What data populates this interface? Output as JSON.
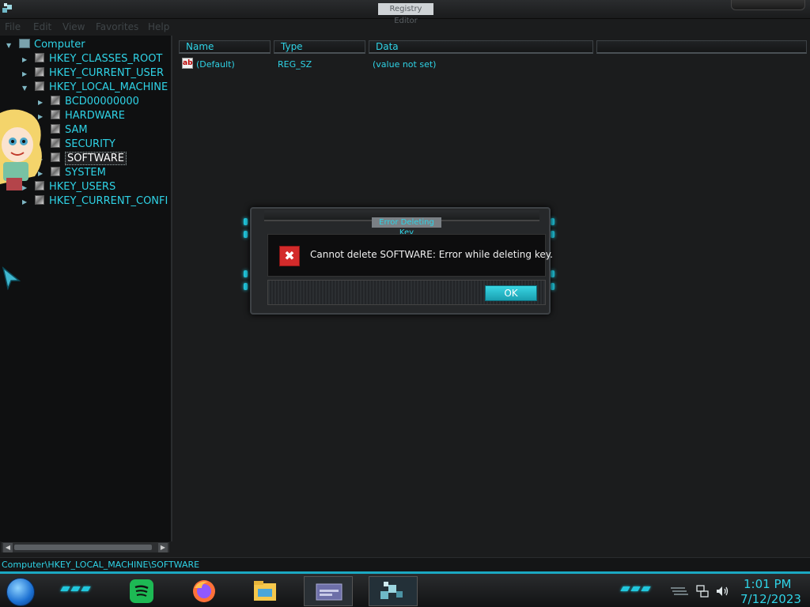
{
  "window": {
    "title": "Registry Editor"
  },
  "menu": [
    "File",
    "Edit",
    "View",
    "Favorites",
    "Help"
  ],
  "tree": {
    "root": "Computer",
    "hives": [
      "HKEY_CLASSES_ROOT",
      "HKEY_CURRENT_USER",
      "HKEY_LOCAL_MACHINE"
    ],
    "local_machine_children": [
      "BCD00000000",
      "HARDWARE",
      "SAM",
      "SECURITY",
      "SOFTWARE",
      "SYSTEM"
    ],
    "bottom_hives": [
      "HKEY_USERS",
      "HKEY_CURRENT_CONFI"
    ]
  },
  "list": {
    "columns": [
      "Name",
      "Type",
      "Data"
    ],
    "rows": [
      {
        "name": "(Default)",
        "type": "REG_SZ",
        "data": "(value not set)"
      }
    ]
  },
  "dialog": {
    "title": "Error Deleting Key",
    "message": "Cannot delete SOFTWARE:  Error while deleting key.",
    "ok_label": "OK"
  },
  "statusbar": {
    "path": "Computer\\HKEY_LOCAL_MACHINE\\SOFTWARE"
  },
  "taskbar": {
    "time": "1:01 PM",
    "date": "7/12/2023",
    "apps": [
      "spotify-icon",
      "firefox-icon",
      "file-explorer-icon",
      "window-preview-icon",
      "registry-editor-icon"
    ]
  },
  "colors": {
    "accent": "#2fd3e6",
    "error": "#d32b2b",
    "background": "#1b1c1d"
  }
}
